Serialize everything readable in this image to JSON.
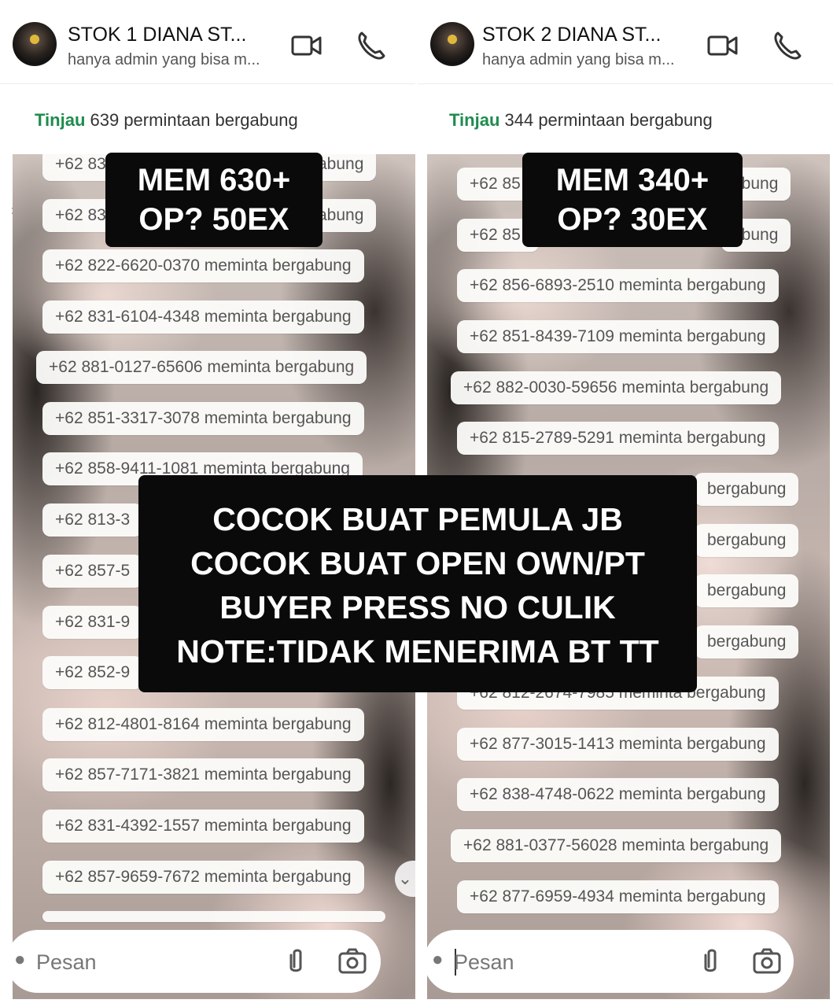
{
  "panels": [
    {
      "title": "STOK 1 DIANA ST...",
      "subtitle": "hanya admin yang bisa m...",
      "join_link": "Tinjau",
      "join_text": " 639 permintaan bergabung",
      "stamp_line1": "MEM 630+",
      "stamp_line2": "OP? 50EX",
      "requests": [
        "+62 83",
        "+62 83",
        "+62 822-6620-0370 meminta bergabung",
        "+62 831-6104-4348 meminta bergabung",
        "+62 881-0127-65606 meminta bergabung",
        "+62 851-3317-3078 meminta bergabung",
        "+62 858-9411-1081 meminta bergabung",
        "+62 813-3",
        "+62 857-5",
        "+62 831-9",
        "+62 852-9",
        "+62 812-4801-8164 meminta bergabung",
        "+62 857-7171-3821 meminta bergabung",
        "+62 831-4392-1557 meminta bergabung",
        "+62 857-9659-7672 meminta bergabung"
      ],
      "request_tail_1": "abung",
      "request_tail_2": "abung",
      "input_placeholder": "Pesan"
    },
    {
      "title": "STOK 2 DIANA ST...",
      "subtitle": "hanya admin yang bisa m...",
      "join_link": "Tinjau",
      "join_text": " 344 permintaan bergabung",
      "stamp_line1": "MEM 340+",
      "stamp_line2": "OP? 30EX",
      "requests": [
        "+62 85",
        "+62 85",
        "+62 856-6893-2510 meminta bergabung",
        "+62 851-8439-7109 meminta bergabung",
        "+62 882-0030-59656 meminta bergabung",
        "+62 815-2789-5291 meminta bergabung",
        "bergabung",
        "bergabung",
        "bergabung",
        "bergabung",
        "+62 812-2674-7985 meminta bergabung",
        "+62 877-3015-1413 meminta bergabung",
        "+62 838-4748-0622 meminta bergabung",
        "+62 881-0377-56028 meminta bergabung",
        "+62 877-6959-4934 meminta bergabung"
      ],
      "request_tail_1": "abung",
      "request_tail_2": "abung",
      "input_placeholder": "Pesan"
    }
  ],
  "overlay": {
    "line1": "COCOK BUAT PEMULA JB",
    "line2": "COCOK BUAT OPEN OWN/PT",
    "line3": "BUYER PRESS NO CULIK",
    "line4": "NOTE:TIDAK MENERIMA BT TT"
  },
  "icons": {
    "video": "video-call-icon",
    "phone": "phone-call-icon",
    "attach": "paperclip-icon",
    "camera": "camera-icon",
    "accent": "#1e8c4e"
  }
}
